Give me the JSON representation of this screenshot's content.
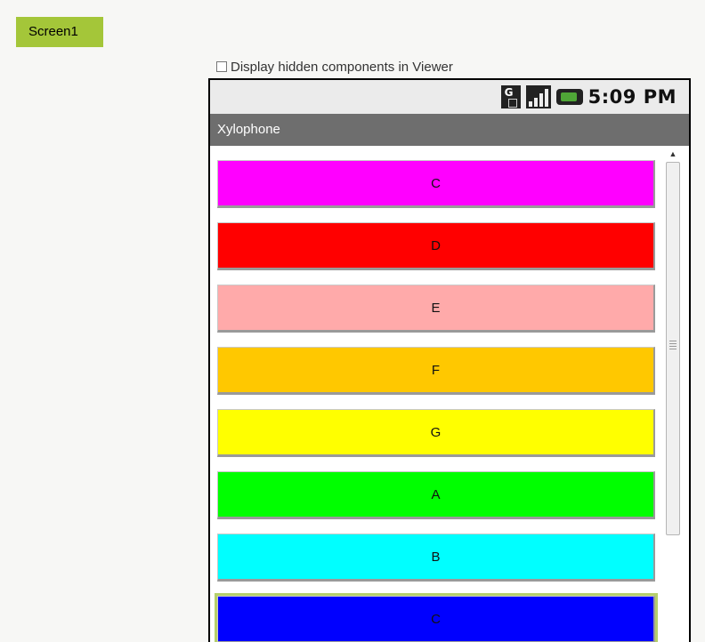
{
  "screen_tab": {
    "label": "Screen1"
  },
  "viewer_option": {
    "label": "Display hidden components in Viewer",
    "checked": false
  },
  "status_bar": {
    "time": "5:09 PM",
    "icons": [
      "network-g-icon",
      "signal-bars-icon",
      "battery-icon"
    ],
    "network_letter": "G"
  },
  "app": {
    "title": "Xylophone"
  },
  "notes": [
    {
      "label": "C",
      "color": "#ff00ff"
    },
    {
      "label": "D",
      "color": "#ff0000"
    },
    {
      "label": "E",
      "color": "#ffaaaa"
    },
    {
      "label": "F",
      "color": "#ffc800"
    },
    {
      "label": "G",
      "color": "#ffff00"
    },
    {
      "label": "A",
      "color": "#00ff00"
    },
    {
      "label": "B",
      "color": "#00ffff"
    },
    {
      "label": "C",
      "color": "#0000ff"
    }
  ],
  "colors": {
    "accent": "#a4c639",
    "titlebar": "#6e6e6e"
  }
}
